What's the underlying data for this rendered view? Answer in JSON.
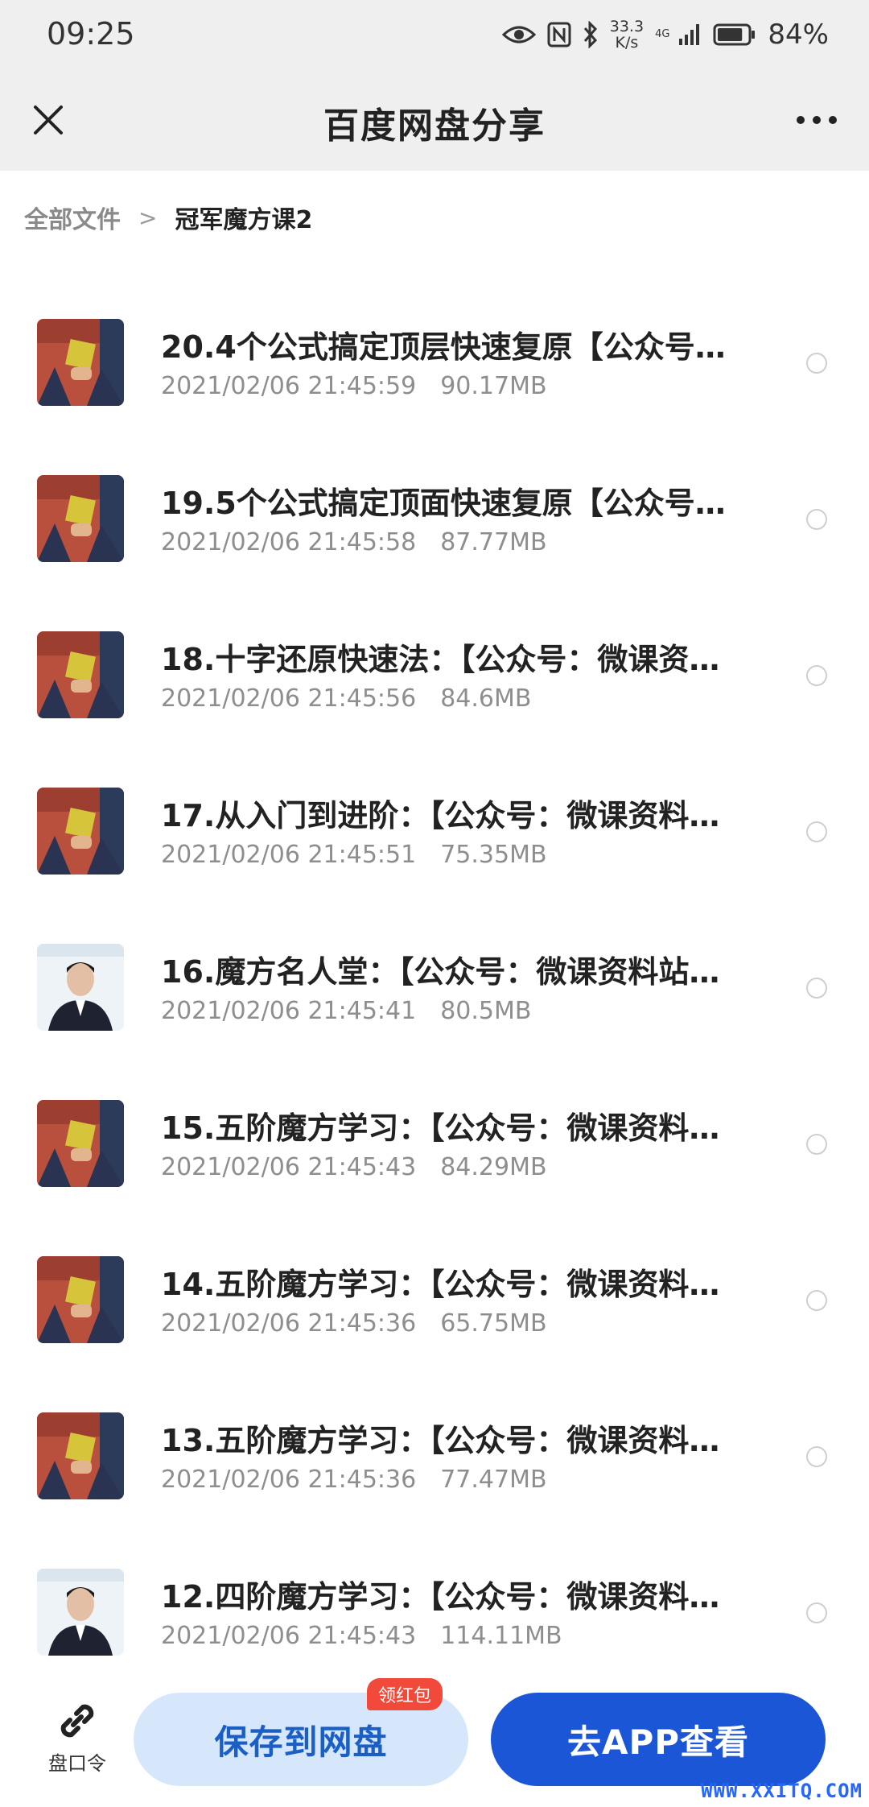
{
  "status_bar": {
    "time": "09:25",
    "speed_value": "33.3",
    "speed_unit": "K/s",
    "network": "4G",
    "battery_percent": "84%",
    "battery_level": 0.84,
    "icons": [
      "eye-icon",
      "nfc-icon",
      "bluetooth-icon",
      "signal-icon",
      "battery-icon"
    ]
  },
  "app_bar": {
    "title": "百度网盘分享",
    "close_icon": "close-icon",
    "more_icon": "more-icon"
  },
  "breadcrumb": {
    "root": "全部文件",
    "separator": ">",
    "current": "冠军魔方课2"
  },
  "files": [
    {
      "name": "20.4个公式搞定顶层快速复原【公众号…",
      "date": "2021/02/06 21:45:59",
      "size": "90.17MB",
      "thumb": "cube"
    },
    {
      "name": "19.5个公式搞定顶面快速复原【公众号…",
      "date": "2021/02/06 21:45:58",
      "size": "87.77MB",
      "thumb": "cube"
    },
    {
      "name": "18.十字还原快速法：【公众号：微课资…",
      "date": "2021/02/06 21:45:56",
      "size": "84.6MB",
      "thumb": "cube"
    },
    {
      "name": "17.从入门到进阶：【公众号：微课资料…",
      "date": "2021/02/06 21:45:51",
      "size": "75.35MB",
      "thumb": "cube"
    },
    {
      "name": "16.魔方名人堂：【公众号：微课资料站…",
      "date": "2021/02/06 21:45:41",
      "size": "80.5MB",
      "thumb": "person"
    },
    {
      "name": "15.五阶魔方学习：【公众号：微课资料…",
      "date": "2021/02/06 21:45:43",
      "size": "84.29MB",
      "thumb": "cube"
    },
    {
      "name": "14.五阶魔方学习：【公众号：微课资料…",
      "date": "2021/02/06 21:45:36",
      "size": "65.75MB",
      "thumb": "cube"
    },
    {
      "name": "13.五阶魔方学习：【公众号：微课资料…",
      "date": "2021/02/06 21:45:36",
      "size": "77.47MB",
      "thumb": "cube"
    },
    {
      "name": "12.四阶魔方学习：【公众号：微课资料…",
      "date": "2021/02/06 21:45:43",
      "size": "114.11MB",
      "thumb": "person"
    }
  ],
  "bottom_bar": {
    "share_code_label": "盘口令",
    "share_code_icon": "link-icon",
    "save_button": "保存到网盘",
    "badge": "领红包",
    "open_app_button": "去APP查看"
  },
  "watermark": "WWW.XXITQ.COM",
  "colors": {
    "primary": "#1a56d6",
    "save_bg": "#d6e7fb",
    "save_text": "#1b5fc4",
    "badge": "#f24a3a",
    "header_bg": "#efefef"
  }
}
